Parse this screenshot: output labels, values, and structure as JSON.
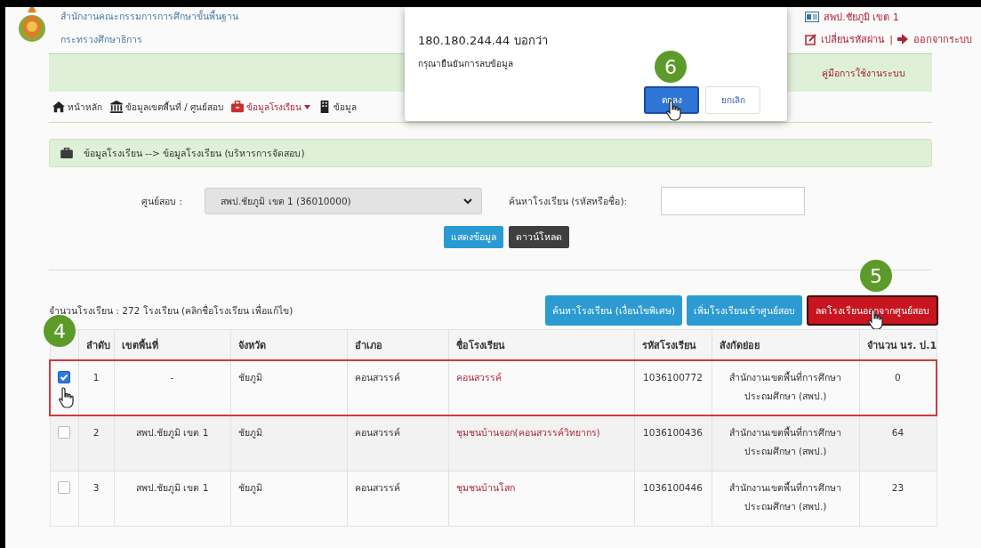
{
  "header": {
    "org_line1": "สำนักงานคณะกรรมการการศึกษาขั้นพื้นฐาน",
    "org_line2": "กระทรวงศึกษาธิการ",
    "user_name": "สพป.ชัยภูมิ เขต 1",
    "change_password": "เปลี่ยนรหัสผ่าน",
    "separator": "|",
    "logout": "ออกจากระบบ"
  },
  "notice_bar": {
    "link": "คู่มือการใช้งานระบบ"
  },
  "nav": [
    {
      "label": "หน้าหลัก",
      "selected": false,
      "has_menu": false
    },
    {
      "label": "ข้อมูลเขตพื้นที่ / ศูนย์สอบ",
      "selected": false,
      "has_menu": false
    },
    {
      "label": "ข้อมูลโรงเรียน",
      "selected": true,
      "has_menu": true
    },
    {
      "label": "ข้อมูล",
      "selected": false,
      "has_menu": false
    }
  ],
  "dialog": {
    "title": "180.180.244.44 บอกว่า",
    "message": "กรุณายืนยันการลบข้อมูล",
    "buttons": [
      {
        "label": "ตกลง",
        "kind": "primary",
        "step": "6",
        "cursor": true
      },
      {
        "label": "ยกเลิก",
        "kind": "default",
        "cursor": false
      }
    ]
  },
  "breadcrumb": "ข้อมูลโรงเรียน --> ข้อมูลโรงเรียน (บริหารการจัดสอบ)",
  "filters": {
    "center_label": "ศูนย์สอบ :",
    "center_value": "สพป.ชัยภูมิ เขต 1 (36010000)",
    "search_label": "ค้นหาโรงเรียน (รหัสหรือชื่อ):"
  },
  "buttons": [
    {
      "label": "แสดงข้อมูล",
      "kind": "primary"
    },
    {
      "label": "ดาวน์โหลด",
      "kind": "dark"
    }
  ],
  "count_text": "จำนวนโรงเรียน : 272 โรงเรียน (คลิกชื่อโรงเรียน เพื่อแก้ไข)",
  "actions": [
    {
      "label": "ค้นหาโรงเรียน (เงื่อนไขพิเศษ)",
      "kind": "info",
      "cursor": false
    },
    {
      "label": "เพิ่มโรงเรียนเข้าศูนย์สอบ",
      "kind": "info",
      "cursor": false
    },
    {
      "label": "ลดโรงเรียนออกจากศูนย์สอบ",
      "kind": "danger",
      "step": "5",
      "cursor": true
    }
  ],
  "table": {
    "step": "4",
    "columns": [
      "ลำดับ",
      "เขตพื้นที่",
      "จังหวัด",
      "อำเภอ",
      "ชื่อโรงเรียน",
      "รหัสโรงเรียน",
      "สังกัดย่อย",
      "จำนวน นร. ป.1"
    ],
    "rows": [
      {
        "checked": true,
        "highlighted": true,
        "cursor": true,
        "cells": [
          "1",
          "-",
          "ชัยภูมิ",
          "คอนสวรรค์",
          "คอนสวรรค์",
          "1036100772",
          "สำนักงานเขตพื้นที่การศึกษาประถมศึกษา (สพป.)",
          "0"
        ]
      },
      {
        "checked": false,
        "highlighted": false,
        "cursor": false,
        "cells": [
          "2",
          "สพป.ชัยภูมิ เขต 1",
          "ชัยภูมิ",
          "คอนสวรรค์",
          "ชุมชนบ้านจอก(คอนสวรรค์วิทยากร)",
          "1036100436",
          "สำนักงานเขตพื้นที่การศึกษาประถมศึกษา (สพป.)",
          "64"
        ]
      },
      {
        "checked": false,
        "highlighted": false,
        "cursor": false,
        "cells": [
          "3",
          "สพป.ชัยภูมิ เขต 1",
          "ชัยภูมิ",
          "คอนสวรรค์",
          "ชุมชนบ้านโสก",
          "1036100446",
          "สำนักงานเขตพื้นที่การศึกษาประถมศึกษา (สพป.)",
          "23"
        ]
      }
    ]
  }
}
